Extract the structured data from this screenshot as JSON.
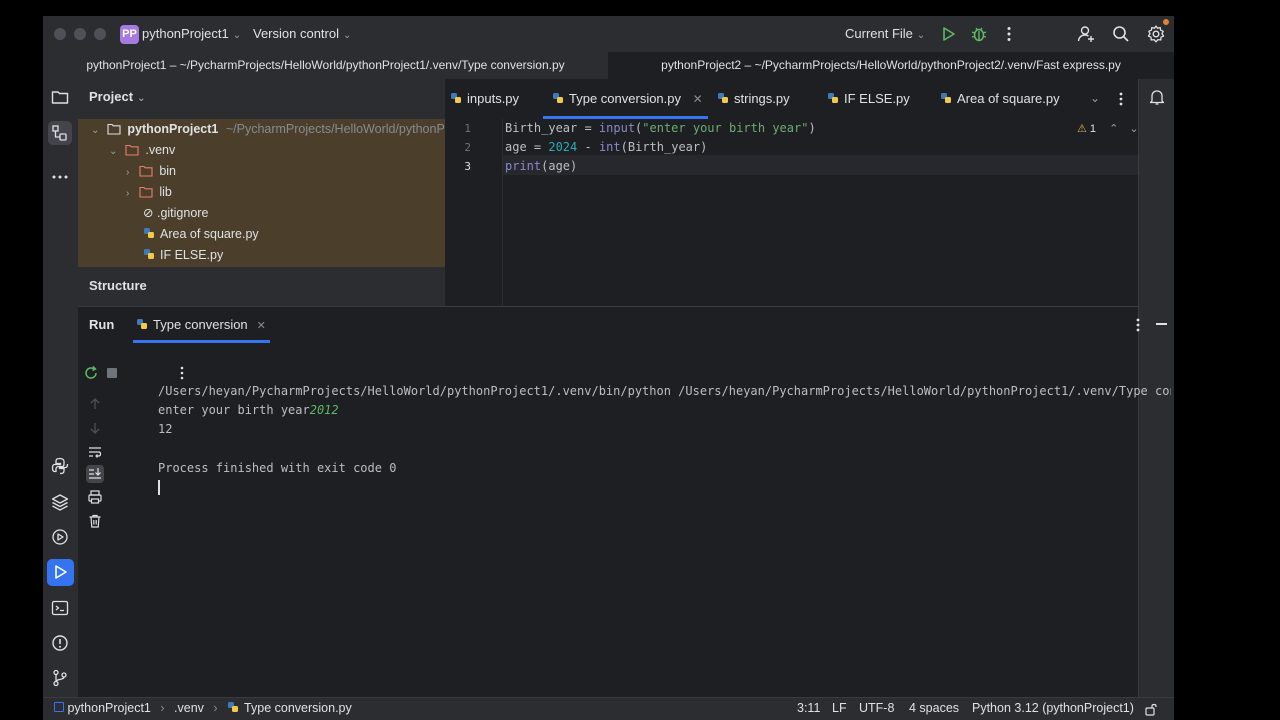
{
  "titlebar": {
    "project_badge": "PP",
    "project_name": "pythonProject1",
    "vcs": "Version control",
    "run_config": "Current File"
  },
  "paths": {
    "left": "pythonProject1 – ~/PycharmProjects/HelloWorld/pythonProject1/.venv/Type conversion.py",
    "right": "pythonProject2 – ~/PycharmProjects/HelloWorld/pythonProject2/.venv/Fast express.py"
  },
  "project_panel": {
    "title": "Project",
    "root_name": "pythonProject1",
    "root_path": "~/PycharmProjects/HelloWorld/pythonProj",
    "items": [
      {
        "label": ".venv"
      },
      {
        "label": "bin"
      },
      {
        "label": "lib"
      },
      {
        "label": ".gitignore"
      },
      {
        "label": "Area of square.py"
      },
      {
        "label": "IF ELSE.py"
      }
    ],
    "structure_label": "Structure"
  },
  "editor_tabs": [
    {
      "label": "inputs.py"
    },
    {
      "label": "Type conversion.py",
      "active": true
    },
    {
      "label": "strings.py"
    },
    {
      "label": "IF ELSE.py"
    },
    {
      "label": "Area of square.py"
    }
  ],
  "editor": {
    "line_numbers": [
      "1",
      "2",
      "3"
    ],
    "warning_count": "1",
    "lines": [
      {
        "a": "Birth_year = ",
        "b": "input",
        "c": "(",
        "d": "\"enter your birth year\"",
        "e": ")"
      },
      {
        "a": "age = ",
        "b": "2024",
        "c": " - ",
        "d": "int",
        "e": "(Birth_year)"
      },
      {
        "a": "print",
        "b": "(age)"
      }
    ]
  },
  "run_panel": {
    "title": "Run",
    "tab_label": "Type conversion",
    "console": {
      "cmd": "/Users/heyan/PycharmProjects/HelloWorld/pythonProject1/.venv/bin/python /Users/heyan/PycharmProjects/HelloWorld/pythonProject1/.venv/Type conversio",
      "prompt": "enter your birth year",
      "input": "2012",
      "output": "12",
      "exit": "Process finished with exit code 0"
    }
  },
  "statusbar": {
    "crumbs": [
      "pythonProject1",
      ".venv",
      "Type conversion.py"
    ],
    "position": "3:11",
    "line_sep": "LF",
    "encoding": "UTF-8",
    "indent": "4 spaces",
    "interpreter": "Python 3.12 (pythonProject1)"
  },
  "colors": {
    "accent": "#3574f0",
    "project_badge": "#a57be0",
    "run_green": "#5fb865",
    "tree_highlight": "#4b3f2b"
  }
}
